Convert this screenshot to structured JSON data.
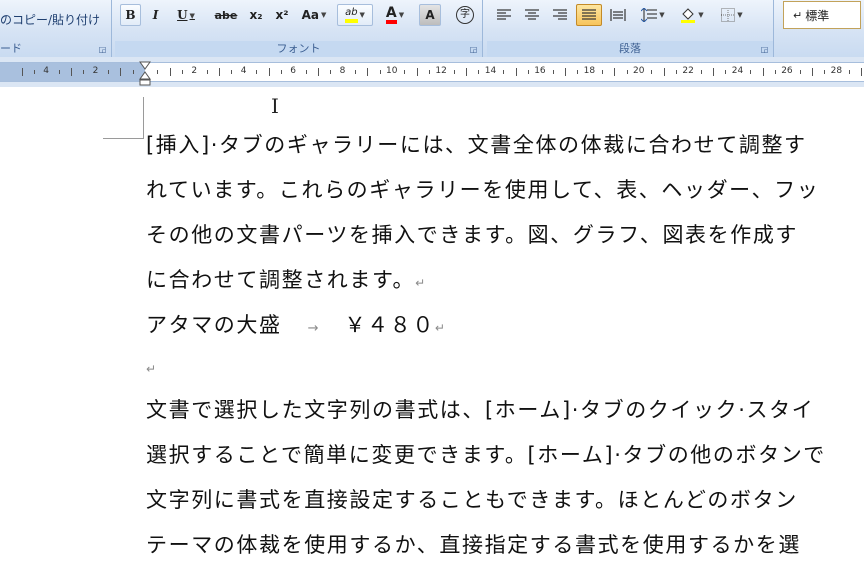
{
  "clipboard": {
    "paste_label": "書式のコピー/貼り付け",
    "group_label": "クリップボード",
    "clip_row_text": "のコピー/貼り付け",
    "clip_label_text": "ード"
  },
  "font_group": {
    "label": "フォント",
    "buttons": {
      "bold": "B",
      "italic": "I",
      "underline": "U",
      "strike": "abe",
      "subscript": "x₂",
      "superscript": "x²",
      "case": "Aa",
      "highlight": "ab",
      "font_color": "A",
      "char_shading": "A",
      "enclose": "字"
    }
  },
  "paragraph_group": {
    "label": "段落"
  },
  "styles": {
    "current_style": "標準"
  },
  "ruler": {
    "labels": [
      "4",
      "2",
      "2",
      "4",
      "6",
      "8",
      "10",
      "12",
      "14",
      "16",
      "18",
      "20",
      "22",
      "24",
      "26",
      "28"
    ]
  },
  "document": {
    "lines": [
      "[挿入]·タブのギャラリーには、文書全体の体裁に合わせて調整す",
      "れています。これらのギャラリーを使用して、表、ヘッダー、フッ",
      "その他の文書パーツを挿入できます。図、グラフ、図表を作成す",
      "に合わせて調整されます。",
      "アタマの大盛",
      "￥４８０",
      "",
      "文書で選択した文字列の書式は、[ホーム]·タブのクイック·スタイ",
      "選択することで簡単に変更できます。[ホーム]·タブの他のボタンで",
      "文字列に書式を直接設定することもできます。ほとんどのボタン",
      "テーマの体裁を使用するか、直接指定する書式を使用するかを選"
    ],
    "paragraph_mark": "↵",
    "tab_mark": "→"
  },
  "colors": {
    "ribbon": "#d6e3f4",
    "highlight": "#ffff00",
    "font_color": "#ff0000"
  }
}
